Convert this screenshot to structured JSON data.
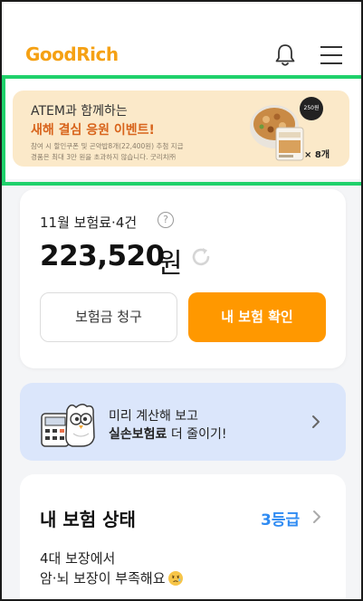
{
  "header": {
    "logo": "GoodRich",
    "icons": [
      "bell-icon",
      "hamburger-menu-icon"
    ]
  },
  "banner": {
    "line1": "ATEM과 함께하는",
    "line2": "새해 결심 응원 이벤트!",
    "line3": "참여 시 할인쿠폰 및 곤약밥8개(22,400원) 추첨 지급",
    "line4": "경품은 최대 3만 원을 초과하지 않습니다. 굿리치㈜",
    "product_badge": "250원",
    "quantity": "× 8개",
    "colors": {
      "background": "#fbe9c9",
      "headline": "#d8641c",
      "outline": "#1fd16b"
    }
  },
  "premium_card": {
    "title": "11월 보험료·4건",
    "help_icon": "?",
    "amount": "223,520",
    "unit": "원",
    "refresh_icon": "refresh-icon",
    "claim_button": "보험금 청구",
    "check_button": "내 보험 확인",
    "accent_color": "#ff9800"
  },
  "promo_card": {
    "line1": "미리 계산해 보고",
    "line2_bold": "실손보험료",
    "line2_rest": " 더 줄이기!",
    "icon": "calculator-owl-icon",
    "background": "#dbe6fb"
  },
  "status_card": {
    "title": "내 보험 상태",
    "grade": "3등급",
    "message_line1": "4대 보장에서",
    "message_line2": "암·뇌 보장이 부족해요",
    "emoji": "worried-face-icon",
    "grade_color": "#2f8bf2"
  }
}
